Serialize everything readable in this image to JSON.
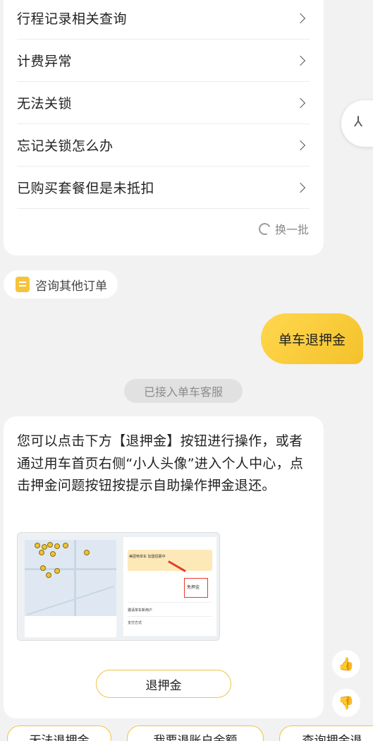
{
  "faq": {
    "items": [
      {
        "label": "行程记录相关查询"
      },
      {
        "label": "计费异常"
      },
      {
        "label": "无法关锁"
      },
      {
        "label": "忘记关锁怎么办"
      },
      {
        "label": "已购买套餐但是未抵扣"
      }
    ],
    "refresh_label": "换一批"
  },
  "side_float": {
    "text": "⅄"
  },
  "consult_chip": {
    "label": "咨询其他订单"
  },
  "user_message": {
    "text": "单车退押金"
  },
  "system_notice": {
    "text": "已接入单车客服"
  },
  "reply": {
    "text": "您可以点击下方【退押金】按钮进行操作，或者通过用车首页右侧“小人头像”进入个人中心，点击押金问题按钮按提示自助操作押金退还。",
    "image_texts": {
      "banner": "美团电单车 加盟招募中",
      "deposit_free": "免押金",
      "row_label": "邀请单车新用户",
      "pay_label": "支付方式"
    },
    "button_label": "退押金"
  },
  "feedback": {
    "like_icon": "thumbs-up-icon",
    "dislike_icon": "thumbs-down-icon"
  },
  "quick_replies": [
    {
      "label": "无法退押金"
    },
    {
      "label": "我要退账户余额"
    },
    {
      "label": "查询押金退"
    }
  ],
  "colors": {
    "accent_yellow": "#f4c12b",
    "background": "#f2f2f2",
    "card": "#ffffff"
  }
}
